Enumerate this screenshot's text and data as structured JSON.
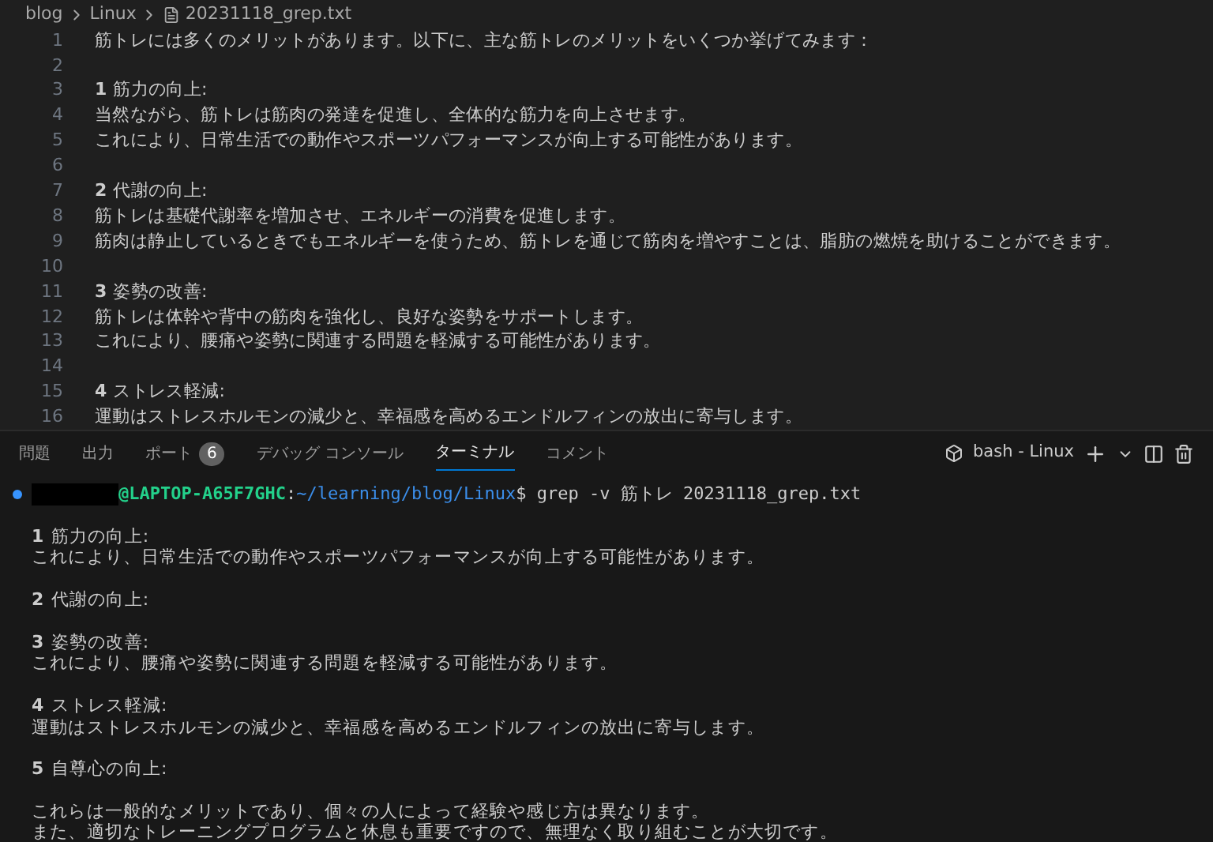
{
  "breadcrumb": [
    "blog",
    "Linux",
    "20231118_grep.txt"
  ],
  "editor": {
    "lines": [
      {
        "number": "1",
        "text": "筋トレには多くのメリットがあります。以下に、主な筋トレのメリットをいくつか挙げてみます："
      },
      {
        "number": "2"
      },
      {
        "number": "3",
        "text": "**1** 筋力の向上:"
      },
      {
        "number": "4",
        "text": "当然ながら、筋トレは筋肉の発達を促進し、全体的な筋力を向上させます。"
      },
      {
        "number": "5",
        "text": "これにより、日常生活での動作やスポーツパフォーマンスが向上する可能性があります。"
      },
      {
        "number": "6"
      },
      {
        "number": "7",
        "text": "**2** 代謝の向上:"
      },
      {
        "number": "8",
        "text": "筋トレは基礎代謝率を増加させ、エネルギーの消費を促進します。"
      },
      {
        "number": "9",
        "text": "筋肉は静止しているときでもエネルギーを使うため、筋トレを通じて筋肉を増やすことは、脂肪の燃焼を助けることができます。"
      },
      {
        "number": "10"
      },
      {
        "number": "11",
        "text": "**3** 姿勢の改善:"
      },
      {
        "number": "12",
        "text": "筋トレは体幹や背中の筋肉を強化し、良好な姿勢をサポートします。"
      },
      {
        "number": "13",
        "text": "これにより、腰痛や姿勢に関連する問題を軽減する可能性があります。"
      },
      {
        "number": "14"
      },
      {
        "number": "15",
        "text": "**4** ストレス軽減:"
      },
      {
        "number": "16",
        "text": "運動はストレスホルモンの減少と、幸福感を高めるエンドルフィンの放出に寄与します。"
      }
    ]
  },
  "panel": {
    "tabs": [
      {
        "label": "問題",
        "selected": false
      },
      {
        "label": "出力",
        "selected": false
      },
      {
        "label": "ポート",
        "badge": "6",
        "selected": false
      },
      {
        "label": "デバッグ コンソール",
        "selected": false
      },
      {
        "label": "ターミナル",
        "selected": true
      },
      {
        "label": "コメント",
        "selected": false
      }
    ],
    "terminal_name": "bash - Linux"
  },
  "terminal": {
    "prompt": [
      {
        "text": "@LAPTOP-A65F7GHC",
        "color": "#23d18b"
      },
      {
        "text": ":",
        "color": "#cccccc"
      },
      {
        "text": "~/learning/blog/Linux",
        "color": "#3b8eea"
      },
      {
        "text": "$ grep -v 筋トレ 20231118_grep.txt",
        "color": "#cccccc"
      }
    ],
    "output_blocks": [
      {
        "lines": [
          "**1** 筋力の向上:",
          "これにより、日常生活での動作やスポーツパフォーマンスが向上する可能性があります。"
        ]
      },
      {
        "lines": [
          "**2** 代謝の向上:"
        ]
      },
      {
        "lines": [
          "**3** 姿勢の改善:",
          "これにより、腰痛や姿勢に関連する問題を軽減する可能性があります。"
        ]
      },
      {
        "lines": [
          "**4** ストレス軽減:",
          "運動はストレスホルモンの減少と、幸福感を高めるエンドルフィンの放出に寄与します。"
        ]
      },
      {
        "lines": [
          "**5** 自尊心の向上:"
        ]
      },
      {
        "lines": [
          "これらは一般的なメリットであり、個々の人によって経験や感じ方は異なります。",
          "また、適切なトレーニングプログラムと休息も重要ですので、無理なく取り組むことが大切です。"
        ]
      }
    ]
  }
}
